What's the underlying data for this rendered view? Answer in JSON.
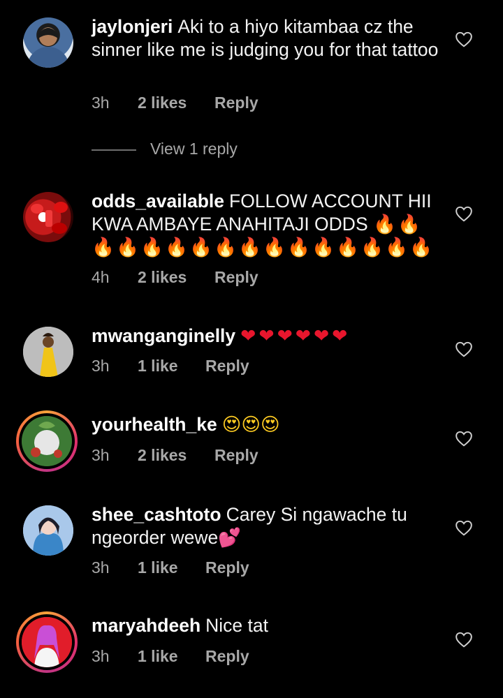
{
  "comments": [
    {
      "username": "jaylonjeri",
      "text": "Aki to a hiyo kitambaa cz the sinner like me is judging you for that tattoo",
      "time": "3h",
      "likes": "2 likes",
      "reply": "Reply",
      "view_replies": "View 1 reply"
    },
    {
      "username": "odds_available",
      "text": "FOLLOW ACCOUNT HII KWA AMBAYE ANAHITAJI ODDS",
      "emojis": "🔥🔥🔥🔥🔥🔥🔥🔥🔥🔥🔥🔥🔥🔥🔥🔥",
      "time": "4h",
      "likes": "2 likes",
      "reply": "Reply"
    },
    {
      "username": "mwanganginelly",
      "emojis": "❤❤❤❤❤❤",
      "time": "3h",
      "likes": "1 like",
      "reply": "Reply"
    },
    {
      "username": "yourhealth_ke",
      "emojis": "😍😍😍",
      "time": "3h",
      "likes": "2 likes",
      "reply": "Reply"
    },
    {
      "username": "shee_cashtoto",
      "text": "Carey Si ngawache tu ngeorder wewe",
      "emojis": "💕",
      "time": "3h",
      "likes": "1 like",
      "reply": "Reply"
    },
    {
      "username": "maryahdeeh",
      "text": "Nice tat",
      "time": "3h",
      "likes": "1 like",
      "reply": "Reply"
    }
  ],
  "icons": {
    "like": "heart-outline-icon"
  },
  "colors": {
    "background": "#000000",
    "text": "#f3f3f3",
    "muted": "#a8a8a8",
    "story_ring_start": "#f9a33a",
    "story_ring_end": "#c13584"
  }
}
